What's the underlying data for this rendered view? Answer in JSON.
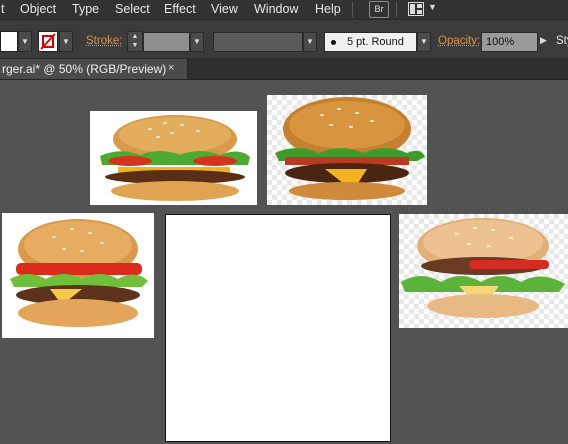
{
  "menubar": {
    "items": [
      "t",
      "Object",
      "Type",
      "Select",
      "Effect",
      "View",
      "Window",
      "Help"
    ],
    "bridge_label": "Br",
    "workspace_icon": "workspace-layout-icon"
  },
  "control": {
    "stroke_label": "Stroke:",
    "brush_label": "5 pt. Round",
    "opacity_label": "Opacity:",
    "opacity_value": "100%",
    "style_label": "Sty"
  },
  "tab": {
    "title": "rger.ai* @ 50% (RGB/Preview)",
    "close": "×"
  },
  "colors": {
    "accent_label": "#e3913f",
    "canvas_bg": "#535353",
    "menubar_bg": "#323232"
  },
  "canvas": {
    "images": [
      {
        "name": "burger-image-1",
        "subject": "cheeseburger photo"
      },
      {
        "name": "burger-image-2",
        "subject": "bacon cheeseburger photo"
      },
      {
        "name": "burger-image-3",
        "subject": "hamburger photo"
      },
      {
        "name": "burger-image-4",
        "subject": "hamburger photo"
      }
    ]
  }
}
